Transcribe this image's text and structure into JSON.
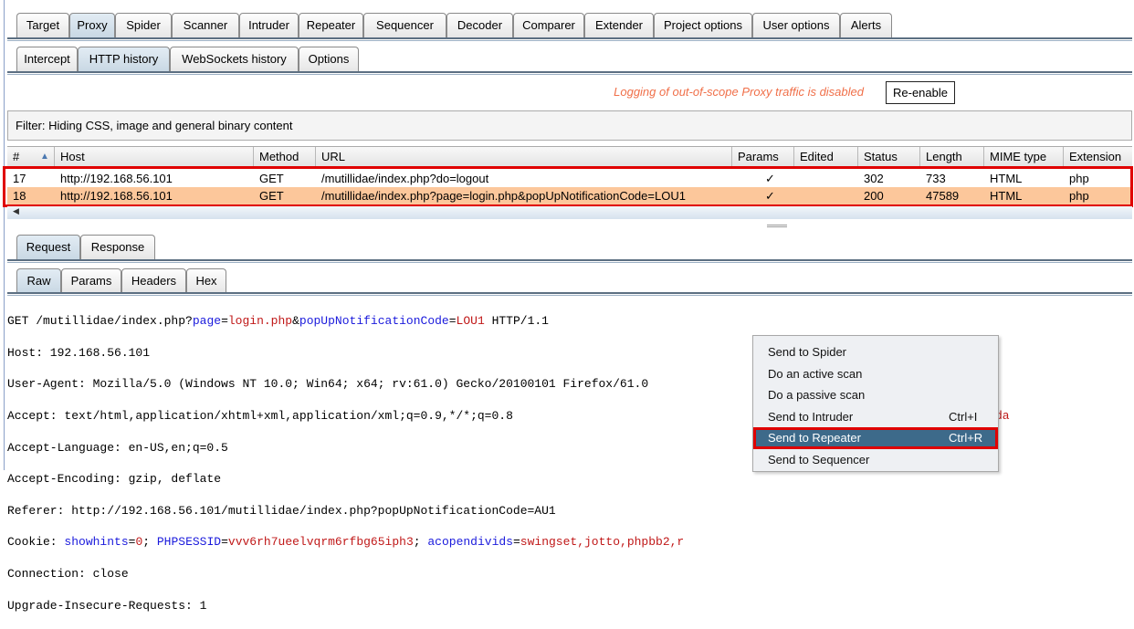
{
  "main_tabs": [
    "Target",
    "Proxy",
    "Spider",
    "Scanner",
    "Intruder",
    "Repeater",
    "Sequencer",
    "Decoder",
    "Comparer",
    "Extender",
    "Project options",
    "User options",
    "Alerts"
  ],
  "proxy_tabs": [
    "Intercept",
    "HTTP history",
    "WebSockets history",
    "Options"
  ],
  "logging_notice": "Logging of out-of-scope Proxy traffic is disabled",
  "reenable_label": "Re-enable",
  "filter_text": "Filter: Hiding CSS, image and general binary content",
  "table": {
    "columns": [
      "#",
      "Host",
      "Method",
      "URL",
      "Params",
      "Edited",
      "Status",
      "Length",
      "MIME type",
      "Extension"
    ],
    "sort_icon": "triangle-up",
    "rows": [
      {
        "num": "17",
        "host": "http://192.168.56.101",
        "method": "GET",
        "url": "/mutillidae/index.php?do=logout",
        "params": "✓",
        "edited": "",
        "status": "302",
        "length": "733",
        "mime": "HTML",
        "ext": "php"
      },
      {
        "num": "18",
        "host": "http://192.168.56.101",
        "method": "GET",
        "url": "/mutillidae/index.php?page=login.php&popUpNotificationCode=LOU1",
        "params": "✓",
        "edited": "",
        "status": "200",
        "length": "47589",
        "mime": "HTML",
        "ext": "php"
      }
    ]
  },
  "viewer_tabs": [
    "Request",
    "Response"
  ],
  "format_tabs": [
    "Raw",
    "Params",
    "Headers",
    "Hex"
  ],
  "request": {
    "l1_a": "GET /mutillidae/index.php?",
    "l1_k1": "page",
    "l1_eq1": "=",
    "l1_v1": "login.php",
    "l1_amp": "&",
    "l1_k2": "popUpNotificationCode",
    "l1_eq2": "=",
    "l1_v2": "LOU1",
    "l1_end": " HTTP/1.1",
    "host": "Host: 192.168.56.101",
    "ua": "User-Agent: Mozilla/5.0 (Windows NT 10.0; Win64; x64; rv:61.0) Gecko/20100101 Firefox/61.0",
    "accept": "Accept: text/html,application/xhtml+xml,application/xml;q=0.9,*/*;q=0.8",
    "lang": "Accept-Language: en-US,en;q=0.5",
    "enc": "Accept-Encoding: gzip, deflate",
    "referer": "Referer: http://192.168.56.101/mutillidae/index.php?popUpNotificationCode=AU1",
    "c_label": "Cookie: ",
    "c_k1": "showhints",
    "c_v1": "0",
    "c_k2": "PHPSESSID",
    "c_v2": "vvv6rh7ueelvqrm6rfbg65iph3",
    "c_k3": "acopendivids",
    "c_v3": "swingset,jotto,phpbb2,r",
    "c_tail": "da",
    "conn": "Connection: close",
    "uir": "Upgrade-Insecure-Requests: 1"
  },
  "context_menu": [
    {
      "label": "Send to Spider",
      "shortcut": ""
    },
    {
      "label": "Do an active scan",
      "shortcut": ""
    },
    {
      "label": "Do a passive scan",
      "shortcut": ""
    },
    {
      "label": "Send to Intruder",
      "shortcut": "Ctrl+I"
    },
    {
      "label": "Send to Repeater",
      "shortcut": "Ctrl+R"
    },
    {
      "label": "Send to Sequencer",
      "shortcut": ""
    }
  ],
  "colors": {
    "selected_row": "#fcc79b",
    "highlight_box": "#e00000",
    "menu_highlight": "#3d6a8a",
    "notice": "#f0704a"
  }
}
